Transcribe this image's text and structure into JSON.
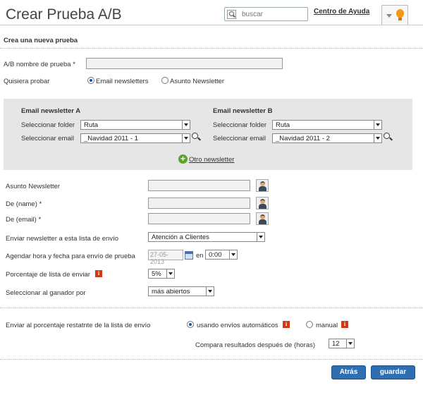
{
  "header": {
    "title": "Crear Prueba A/B",
    "search_placeholder": "buscar",
    "help_link": "Centro de Ayuda"
  },
  "form": {
    "section_title": "Crea una nueva prueba",
    "test_name_label": "A/B nombre de prueba *",
    "test_name_value": "",
    "test_type_label": "Quisiera probar",
    "test_type_options": [
      "Email newsletters",
      "Asunto Newsletter"
    ],
    "test_type_selected": "Email newsletters"
  },
  "newsletter_a": {
    "title": "Email newsletter A",
    "folder_label": "Seleccionar folder",
    "folder_value": "Ruta",
    "email_label": "Seleccionar email",
    "email_value": "_Navidad 2011 - 1"
  },
  "newsletter_b": {
    "title": "Email newsletter B",
    "folder_label": "Seleccionar folder",
    "folder_value": "Ruta",
    "email_label": "Seleccionar email",
    "email_value": "_Navidad 2011 - 2"
  },
  "other_newsletter_link": "Otro newsletter",
  "details": {
    "subject_label": "Asunto Newsletter",
    "from_name_label": "De (name) *",
    "from_email_label": "De (email) *",
    "send_list_label": "Enviar newsletter a esta lista de envío",
    "send_list_value": "Atención a Clientes",
    "schedule_label": "Agendar hora y fecha para envío de prueba",
    "schedule_date": "27-05-2013",
    "schedule_en": "en",
    "schedule_time": "0:00",
    "percent_label": "Porcentaje de lista de enviar",
    "percent_value": "5%",
    "winner_label": "Seleccionar al ganador por",
    "winner_value": "más abiertos"
  },
  "remaining": {
    "label": "Enviar al porcentaje restatnte de la lista de envío",
    "options": [
      "usando envíos automáticos",
      "manual"
    ],
    "selected": "usando envíos automáticos",
    "compare_label": "Compara resultados después de (horas)",
    "compare_value": "12"
  },
  "buttons": {
    "back": "Atrás",
    "save": "guardar"
  },
  "colors": {
    "primary_button": "#2f6fb0",
    "panel_bg": "#e6e6e6",
    "info_icon": "#d03a12",
    "plus_icon": "#5da42a"
  }
}
